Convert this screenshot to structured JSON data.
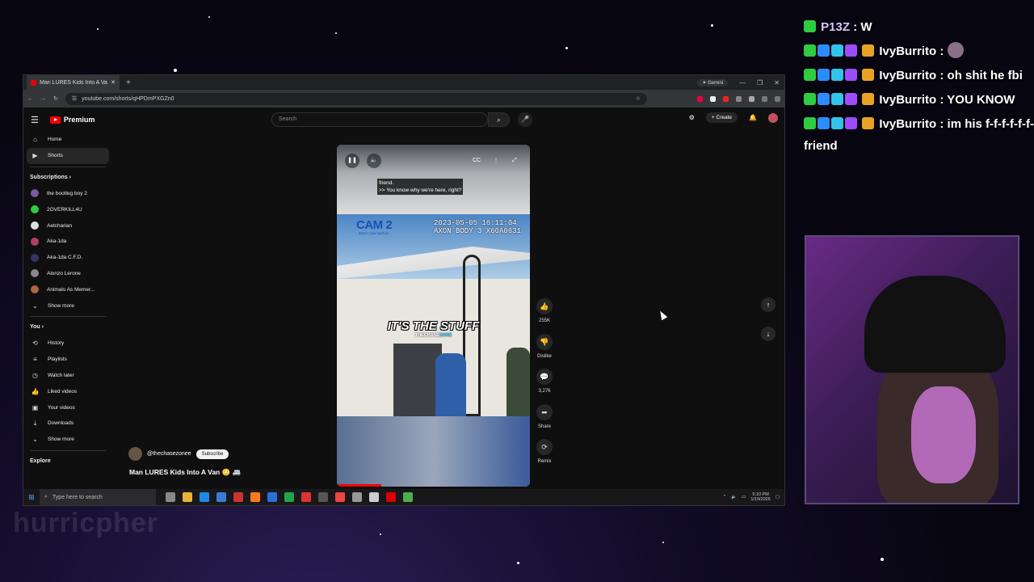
{
  "browser": {
    "tab_title": "Man LURES Kids Into A Van",
    "gemini_label": "Gemini",
    "url": "youtube.com/shorts/qHPDmPXGZn0"
  },
  "youtube": {
    "brand": "Premium",
    "search_placeholder": "Search",
    "create_label": "Create",
    "nav": [
      {
        "label": "Home",
        "icon": "home-icon"
      },
      {
        "label": "Shorts",
        "icon": "shorts-icon"
      }
    ],
    "subscriptions_header": "Subscriptions",
    "subscriptions": [
      {
        "label": "the bootleg boy 2",
        "color": "#7a5a9a"
      },
      {
        "label": "2OVERKILL4U",
        "color": "#2ecc40"
      },
      {
        "label": "Aetcharian",
        "color": "#dddddd"
      },
      {
        "label": "Aka-1da",
        "color": "#b04060"
      },
      {
        "label": "Aka-1da C.F.D.",
        "color": "#333366"
      },
      {
        "label": "Alonzo Lerone",
        "color": "#888888"
      },
      {
        "label": "Animals As Memer...",
        "color": "#aa6644"
      }
    ],
    "show_more": "Show more",
    "you_header": "You",
    "you_items": [
      {
        "label": "History",
        "icon": "history-icon"
      },
      {
        "label": "Playlists",
        "icon": "playlists-icon"
      },
      {
        "label": "Watch later",
        "icon": "watch-later-icon"
      },
      {
        "label": "Liked videos",
        "icon": "like-icon"
      },
      {
        "label": "Your videos",
        "icon": "your-videos-icon"
      },
      {
        "label": "Downloads",
        "icon": "download-icon"
      }
    ],
    "explore_header": "Explore",
    "short": {
      "caption_line1": "friend.",
      "caption_line2": ">> You know why we're here, right?",
      "cam_label": "CAM 2",
      "cam_sub": "BODY CAM WATCH",
      "timestamp_line1": "2023-05-05 16:11:04",
      "timestamp_line2": "AXON BODY 3 X60A0631",
      "overlay_text": "IT'S THE STUFF",
      "watermark_a": "THECHASE",
      "watermark_b": "ZONE",
      "channel": "@thechasezonee",
      "subscribe": "Subscribe",
      "title": "Man LURES Kids Into A Van 😳 🚐",
      "progress": 0.23
    },
    "actions": [
      {
        "icon": "like-icon",
        "label": "255K"
      },
      {
        "icon": "dislike-icon",
        "label": "Dislike"
      },
      {
        "icon": "comment-icon",
        "label": "3,276"
      },
      {
        "icon": "share-icon",
        "label": "Share"
      },
      {
        "icon": "remix-icon",
        "label": "Remix"
      }
    ]
  },
  "taskbar": {
    "search_placeholder": "Type here to search",
    "time": "5:10 PM",
    "date": "1/19/2026"
  },
  "chat": [
    {
      "user": "P13Z",
      "text": "W"
    },
    {
      "user": "IvyBurrito",
      "text": ""
    },
    {
      "user": "IvyBurrito",
      "text": "oh shit he fbi"
    },
    {
      "user": "IvyBurrito",
      "text": "YOU KNOW"
    },
    {
      "user": "IvyBurrito",
      "text": "im his f-f-f-f-f-f-friend"
    }
  ],
  "background_watermark": "hurricpher",
  "colors": {
    "accent_red": "#ff0000",
    "chat_badge_green": "#2ecc40",
    "chat_badge_blue": "#2a8cff"
  }
}
